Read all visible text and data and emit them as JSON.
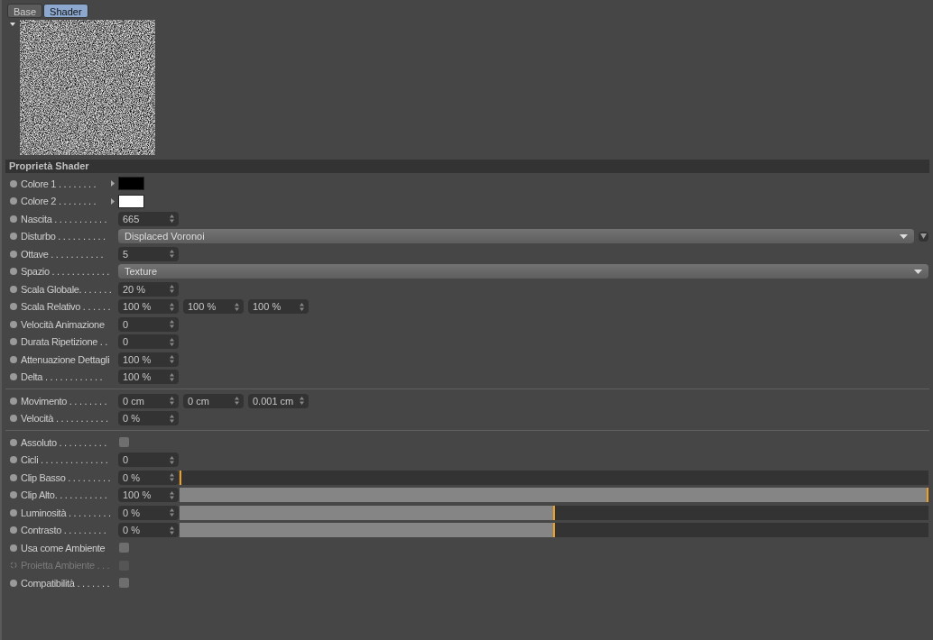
{
  "tabs": [
    {
      "label": "Base",
      "selected": false
    },
    {
      "label": "Shader",
      "selected": true
    }
  ],
  "preview": {
    "expanded": true
  },
  "section": {
    "title": "Proprietà Shader"
  },
  "groups": [
    {
      "rows": [
        {
          "kind": "color",
          "label": "Colore 1 . . . . . . . .",
          "color": "#000000"
        },
        {
          "kind": "color",
          "label": "Colore 2 . . . . . . . .",
          "color": "#ffffff"
        },
        {
          "kind": "number",
          "label": "Nascita . . . . . . . . . . .",
          "values": [
            "665"
          ]
        },
        {
          "kind": "dropdown",
          "label": "Disturbo . . . . . . . . . .",
          "value": "Displaced Voronoi",
          "extra": true
        },
        {
          "kind": "number",
          "label": "Ottave . . . . . . . . . . .",
          "values": [
            "5"
          ]
        },
        {
          "kind": "dropdown",
          "label": "Spazio . . . . . . . . . . . .",
          "value": "Texture",
          "extra": false
        },
        {
          "kind": "number",
          "label": "Scala Globale. . . . . . .",
          "values": [
            "20 %"
          ]
        },
        {
          "kind": "number",
          "label": "Scala Relativo . . . . . .",
          "values": [
            "100 %",
            "100 %",
            "100 %"
          ]
        },
        {
          "kind": "number",
          "label": "Velocità Animazione",
          "values": [
            "0"
          ]
        },
        {
          "kind": "number",
          "label": "Durata Ripetizione . .",
          "values": [
            "0"
          ]
        },
        {
          "kind": "number",
          "label": "Attenuazione Dettagli",
          "values": [
            "100 %"
          ]
        },
        {
          "kind": "number",
          "label": "Delta . . . . . . . . . . . .",
          "values": [
            "100 %"
          ]
        }
      ]
    },
    {
      "rows": [
        {
          "kind": "number",
          "label": "Movimento . . . . . . . .",
          "values": [
            "0 cm",
            "0 cm",
            "0.001 cm"
          ]
        },
        {
          "kind": "number",
          "label": "Velocità . . . . . . . . . . .",
          "values": [
            "0 %"
          ]
        }
      ]
    },
    {
      "rows": [
        {
          "kind": "checkbox",
          "label": "Assoluto . . . . . . . . . .",
          "checked": false,
          "disabled": false
        },
        {
          "kind": "number",
          "label": "Cicli . . . . . . . . . . . . . .",
          "values": [
            "0"
          ]
        },
        {
          "kind": "slider",
          "label": "Clip Basso . . . . . . . . .",
          "values": [
            "0 %"
          ],
          "level": 0
        },
        {
          "kind": "slider",
          "label": "Clip Alto. . . . . . . . . . .",
          "values": [
            "100 %"
          ],
          "level": 1
        },
        {
          "kind": "slider",
          "label": "Luminosità . . . . . . . . .",
          "values": [
            "0 %"
          ],
          "level": 0.5
        },
        {
          "kind": "slider",
          "label": "Contrasto . . . . . . . . .",
          "values": [
            "0 %"
          ],
          "level": 0.5
        },
        {
          "kind": "checkbox",
          "label": "Usa come Ambiente",
          "checked": false,
          "disabled": false
        },
        {
          "kind": "checkbox",
          "label": "Proietta Ambiente . . .",
          "checked": false,
          "disabled": true
        },
        {
          "kind": "checkbox",
          "label": "Compatibilità . . . . . . .",
          "checked": false,
          "disabled": false
        }
      ]
    }
  ]
}
